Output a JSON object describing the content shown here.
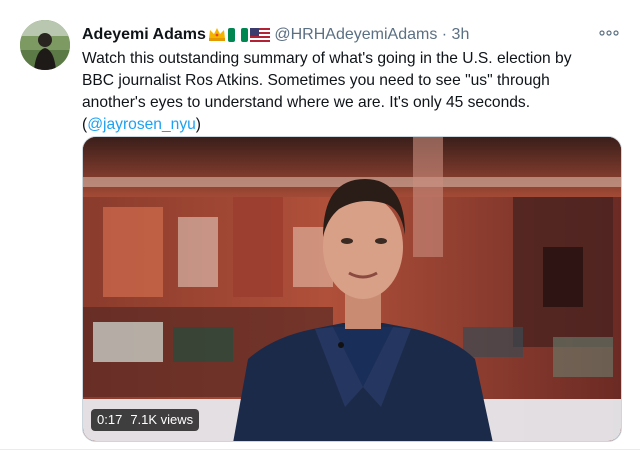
{
  "tweet": {
    "author_name": "Adeyemi Adams",
    "badges": [
      "crown-emoji",
      "nigeria-flag-emoji",
      "us-flag-emoji"
    ],
    "handle": "@HRHAdeyemiAdams",
    "separator": "·",
    "time": "3h",
    "text_line1": "Watch this outstanding summary of what's going in the U.S. election by",
    "text_line2": "BBC journalist Ros Atkins. Sometimes you need to see \"us\" through",
    "text_line3": "another's eyes to understand where we are. It's only 45 seconds.",
    "mention_open": "(",
    "mention": "@jayrosen_nyu",
    "mention_close": ")"
  },
  "video": {
    "duration": "0:17",
    "views": "7.1K views"
  },
  "colors": {
    "link": "#1da1f2",
    "muted": "#5b7083",
    "text": "#0f1419"
  }
}
